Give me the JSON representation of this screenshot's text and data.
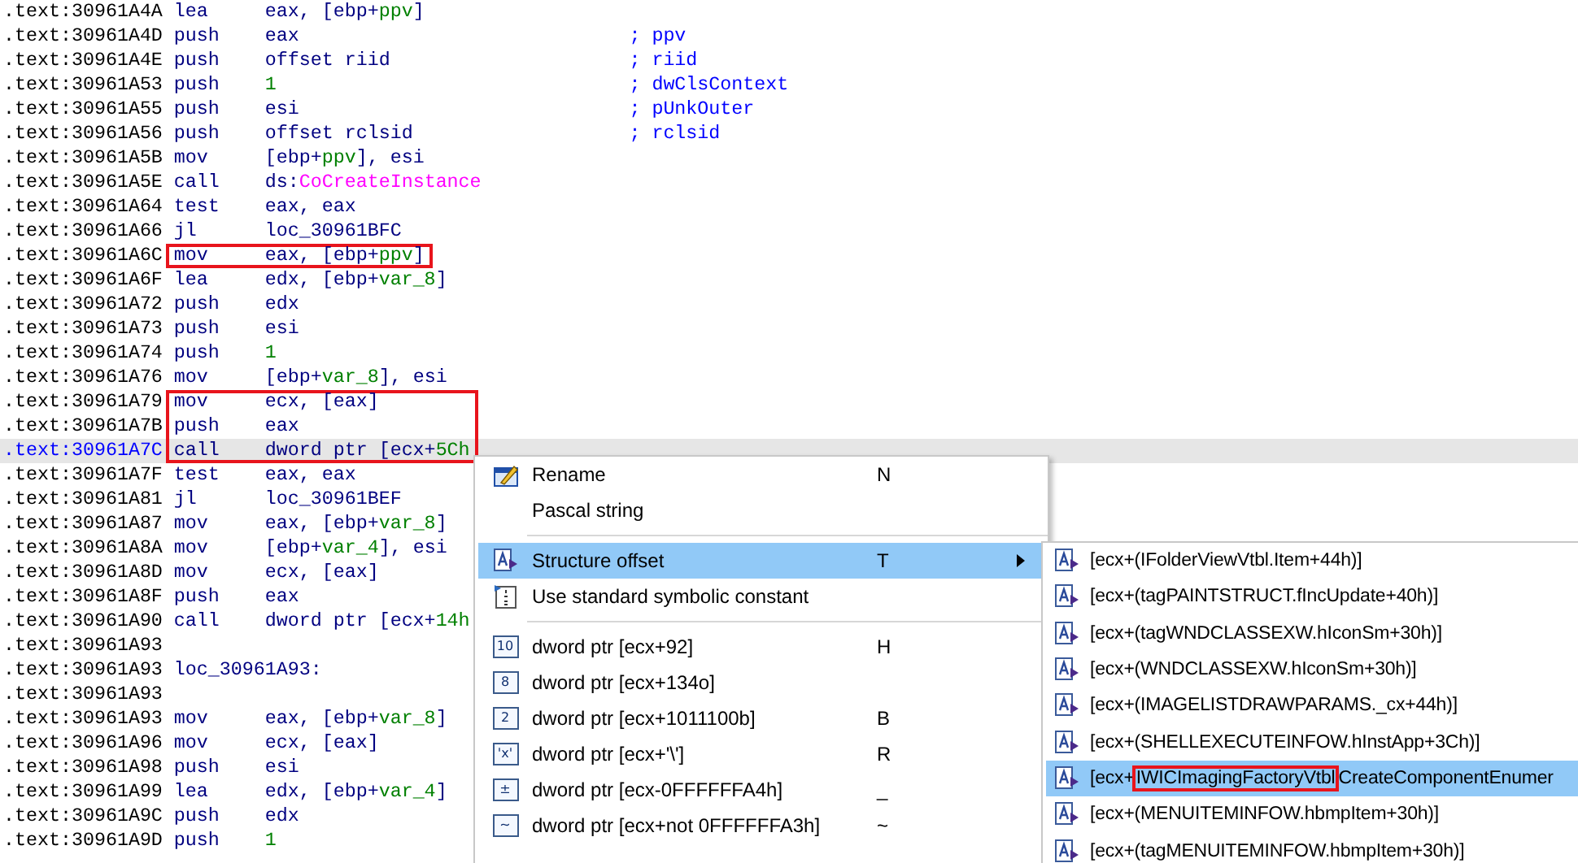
{
  "code": {
    "lines": [
      {
        "address": ".text:30961A4A",
        "mnemonic": "lea",
        "operand": [
          {
            "text": "eax, [ebp+",
            "kind": "plain"
          },
          {
            "text": "ppv",
            "kind": "name"
          },
          {
            "text": "]",
            "kind": "plain"
          }
        ],
        "marked": false,
        "selected": false
      },
      {
        "address": ".text:30961A4D",
        "mnemonic": "push",
        "operand": [
          {
            "text": "eax",
            "kind": "plain"
          }
        ],
        "comment": "; ppv",
        "marked": false,
        "selected": false
      },
      {
        "address": ".text:30961A4E",
        "mnemonic": "push",
        "operand": [
          {
            "text": "offset riid",
            "kind": "plain"
          }
        ],
        "comment": "; riid",
        "marked": false,
        "selected": false
      },
      {
        "address": ".text:30961A53",
        "mnemonic": "push",
        "operand": [
          {
            "text": "1",
            "kind": "num"
          }
        ],
        "comment": "; dwClsContext",
        "marked": false,
        "selected": false
      },
      {
        "address": ".text:30961A55",
        "mnemonic": "push",
        "operand": [
          {
            "text": "esi",
            "kind": "plain"
          }
        ],
        "comment": "; pUnkOuter",
        "marked": false,
        "selected": false
      },
      {
        "address": ".text:30961A56",
        "mnemonic": "push",
        "operand": [
          {
            "text": "offset rclsid",
            "kind": "plain"
          }
        ],
        "comment": "; rclsid",
        "marked": false,
        "selected": false
      },
      {
        "address": ".text:30961A5B",
        "mnemonic": "mov",
        "operand": [
          {
            "text": "[ebp+",
            "kind": "plain"
          },
          {
            "text": "ppv",
            "kind": "name"
          },
          {
            "text": "], esi",
            "kind": "plain"
          }
        ],
        "marked": false,
        "selected": false
      },
      {
        "address": ".text:30961A5E",
        "mnemonic": "call",
        "operand": [
          {
            "text": "ds:",
            "kind": "plain"
          },
          {
            "text": "CoCreateInstance",
            "kind": "import"
          }
        ],
        "marked": false,
        "selected": false
      },
      {
        "address": ".text:30961A64",
        "mnemonic": "test",
        "operand": [
          {
            "text": "eax, eax",
            "kind": "plain"
          }
        ],
        "marked": false,
        "selected": false
      },
      {
        "address": ".text:30961A66",
        "mnemonic": "jl",
        "operand": [
          {
            "text": "loc_30961BFC",
            "kind": "plain"
          }
        ],
        "marked": false,
        "selected": false
      },
      {
        "address": ".text:30961A6C",
        "mnemonic": "mov",
        "operand": [
          {
            "text": "eax, [ebp+",
            "kind": "plain"
          },
          {
            "text": "ppv",
            "kind": "name"
          },
          {
            "text": "]",
            "kind": "plain"
          }
        ],
        "marked": true,
        "selected": false
      },
      {
        "address": ".text:30961A6F",
        "mnemonic": "lea",
        "operand": [
          {
            "text": "edx, [ebp+",
            "kind": "plain"
          },
          {
            "text": "var_8",
            "kind": "name"
          },
          {
            "text": "]",
            "kind": "plain"
          }
        ],
        "marked": false,
        "selected": false
      },
      {
        "address": ".text:30961A72",
        "mnemonic": "push",
        "operand": [
          {
            "text": "edx",
            "kind": "plain"
          }
        ],
        "marked": false,
        "selected": false
      },
      {
        "address": ".text:30961A73",
        "mnemonic": "push",
        "operand": [
          {
            "text": "esi",
            "kind": "plain"
          }
        ],
        "marked": false,
        "selected": false
      },
      {
        "address": ".text:30961A74",
        "mnemonic": "push",
        "operand": [
          {
            "text": "1",
            "kind": "num"
          }
        ],
        "marked": false,
        "selected": false
      },
      {
        "address": ".text:30961A76",
        "mnemonic": "mov",
        "operand": [
          {
            "text": "[ebp+",
            "kind": "plain"
          },
          {
            "text": "var_8",
            "kind": "name"
          },
          {
            "text": "], esi",
            "kind": "plain"
          }
        ],
        "marked": false,
        "selected": false
      },
      {
        "address": ".text:30961A79",
        "mnemonic": "mov",
        "operand": [
          {
            "text": "ecx, [eax]",
            "kind": "plain"
          }
        ],
        "marked": true,
        "selected": false
      },
      {
        "address": ".text:30961A7B",
        "mnemonic": "push",
        "operand": [
          {
            "text": "eax",
            "kind": "plain"
          }
        ],
        "marked": true,
        "selected": false
      },
      {
        "address": ".text:30961A7C",
        "mnemonic": "call",
        "operand": [
          {
            "text": "dword ptr [ecx+",
            "kind": "plain"
          },
          {
            "text": "5Ch",
            "kind": "num"
          }
        ],
        "marked": true,
        "selected": true
      },
      {
        "address": ".text:30961A7F",
        "mnemonic": "test",
        "operand": [
          {
            "text": "eax, eax",
            "kind": "plain"
          }
        ],
        "marked": false,
        "selected": false
      },
      {
        "address": ".text:30961A81",
        "mnemonic": "jl",
        "operand": [
          {
            "text": "loc_30961BEF",
            "kind": "plain"
          }
        ],
        "marked": false,
        "selected": false
      },
      {
        "address": ".text:30961A87",
        "mnemonic": "mov",
        "operand": [
          {
            "text": "eax, [ebp+",
            "kind": "plain"
          },
          {
            "text": "var_8",
            "kind": "name"
          },
          {
            "text": "]",
            "kind": "plain"
          }
        ],
        "marked": false,
        "selected": false
      },
      {
        "address": ".text:30961A8A",
        "mnemonic": "mov",
        "operand": [
          {
            "text": "[ebp+",
            "kind": "plain"
          },
          {
            "text": "var_4",
            "kind": "name"
          },
          {
            "text": "], esi",
            "kind": "plain"
          }
        ],
        "marked": false,
        "selected": false
      },
      {
        "address": ".text:30961A8D",
        "mnemonic": "mov",
        "operand": [
          {
            "text": "ecx, [eax]",
            "kind": "plain"
          }
        ],
        "marked": false,
        "selected": false
      },
      {
        "address": ".text:30961A8F",
        "mnemonic": "push",
        "operand": [
          {
            "text": "eax",
            "kind": "plain"
          }
        ],
        "marked": false,
        "selected": false
      },
      {
        "address": ".text:30961A90",
        "mnemonic": "call",
        "operand": [
          {
            "text": "dword ptr [ecx+",
            "kind": "plain"
          },
          {
            "text": "14h",
            "kind": "num"
          }
        ],
        "marked": false,
        "selected": false
      },
      {
        "address": ".text:30961A93",
        "marked": false,
        "selected": false
      },
      {
        "address": ".text:30961A93",
        "mnemonic": "loc_30961A93:",
        "marked": false,
        "selected": false
      },
      {
        "address": ".text:30961A93",
        "marked": false,
        "selected": false
      },
      {
        "address": ".text:30961A93",
        "mnemonic": "mov",
        "operand": [
          {
            "text": "eax, [ebp+",
            "kind": "plain"
          },
          {
            "text": "var_8",
            "kind": "name"
          },
          {
            "text": "]",
            "kind": "plain"
          }
        ],
        "marked": false,
        "selected": false
      },
      {
        "address": ".text:30961A96",
        "mnemonic": "mov",
        "operand": [
          {
            "text": "ecx, [eax]",
            "kind": "plain"
          }
        ],
        "marked": false,
        "selected": false
      },
      {
        "address": ".text:30961A98",
        "mnemonic": "push",
        "operand": [
          {
            "text": "esi",
            "kind": "plain"
          }
        ],
        "marked": false,
        "selected": false
      },
      {
        "address": ".text:30961A99",
        "mnemonic": "lea",
        "operand": [
          {
            "text": "edx, [ebp+",
            "kind": "plain"
          },
          {
            "text": "var_4",
            "kind": "name"
          },
          {
            "text": "]",
            "kind": "plain"
          }
        ],
        "marked": false,
        "selected": false
      },
      {
        "address": ".text:30961A9C",
        "mnemonic": "push",
        "operand": [
          {
            "text": "edx",
            "kind": "plain"
          }
        ],
        "marked": false,
        "selected": false
      },
      {
        "address": ".text:30961A9D",
        "mnemonic": "push",
        "operand": [
          {
            "text": "1",
            "kind": "num"
          }
        ],
        "marked": false,
        "selected": false
      }
    ]
  },
  "context_menu": {
    "items": [
      {
        "kind": "pencil",
        "label": "Rename",
        "shortcut": "N",
        "selected": false
      },
      {
        "kind": "plain",
        "label": "Pascal string",
        "selected": false
      },
      {
        "kind": "separator"
      },
      {
        "kind": "struct",
        "label": "Structure offset",
        "shortcut": "T",
        "has_submenu": true,
        "selected": true
      },
      {
        "kind": "constant",
        "label": "Use standard symbolic constant",
        "selected": false
      },
      {
        "kind": "separator"
      },
      {
        "kind": "badge",
        "icon_text": "10",
        "label": "dword ptr [ecx+92]",
        "shortcut": "H",
        "selected": false
      },
      {
        "kind": "badge",
        "icon_text": "8",
        "label": "dword ptr [ecx+134o]",
        "selected": false
      },
      {
        "kind": "badge",
        "icon_text": "2",
        "label": "dword ptr [ecx+1011100b]",
        "shortcut": "B",
        "selected": false
      },
      {
        "kind": "badge",
        "icon_text": "'x'",
        "label": "dword ptr [ecx+'\\']",
        "shortcut": "R",
        "selected": false
      },
      {
        "kind": "badge",
        "icon_text": "±",
        "label": "dword ptr [ecx-0FFFFFFA4h]",
        "shortcut": "_",
        "selected": false
      },
      {
        "kind": "badge",
        "icon_text": "~",
        "label": "dword ptr [ecx+not 0FFFFFFA3h]",
        "shortcut": "~",
        "selected": false
      }
    ]
  },
  "submenu": {
    "items": [
      {
        "label": "[ecx+(IFolderViewVtbl.Item+44h)]",
        "selected": false
      },
      {
        "label": "[ecx+(tagPAINTSTRUCT.fIncUpdate+40h)]",
        "selected": false
      },
      {
        "label": "[ecx+(tagWNDCLASSEXW.hIconSm+30h)]",
        "selected": false
      },
      {
        "label": "[ecx+(WNDCLASSEXW.hIconSm+30h)]",
        "selected": false
      },
      {
        "label": "[ecx+(IMAGELISTDRAWPARAMS._cx+44h)]",
        "selected": false
      },
      {
        "label": "[ecx+(SHELLEXECUTEINFOW.hInstApp+3Ch)]",
        "selected": false
      },
      {
        "label": "[ecx+",
        "boxed": "IWICImagingFactoryVtbl",
        "rest": "CreateComponentEnumer",
        "selected": true
      },
      {
        "label": "[ecx+(MENUITEMINFOW.hbmpItem+30h)]",
        "selected": false
      },
      {
        "label": "[ecx+(tagMENUITEMINFOW.hbmpItem+30h)]",
        "selected": false
      }
    ]
  }
}
